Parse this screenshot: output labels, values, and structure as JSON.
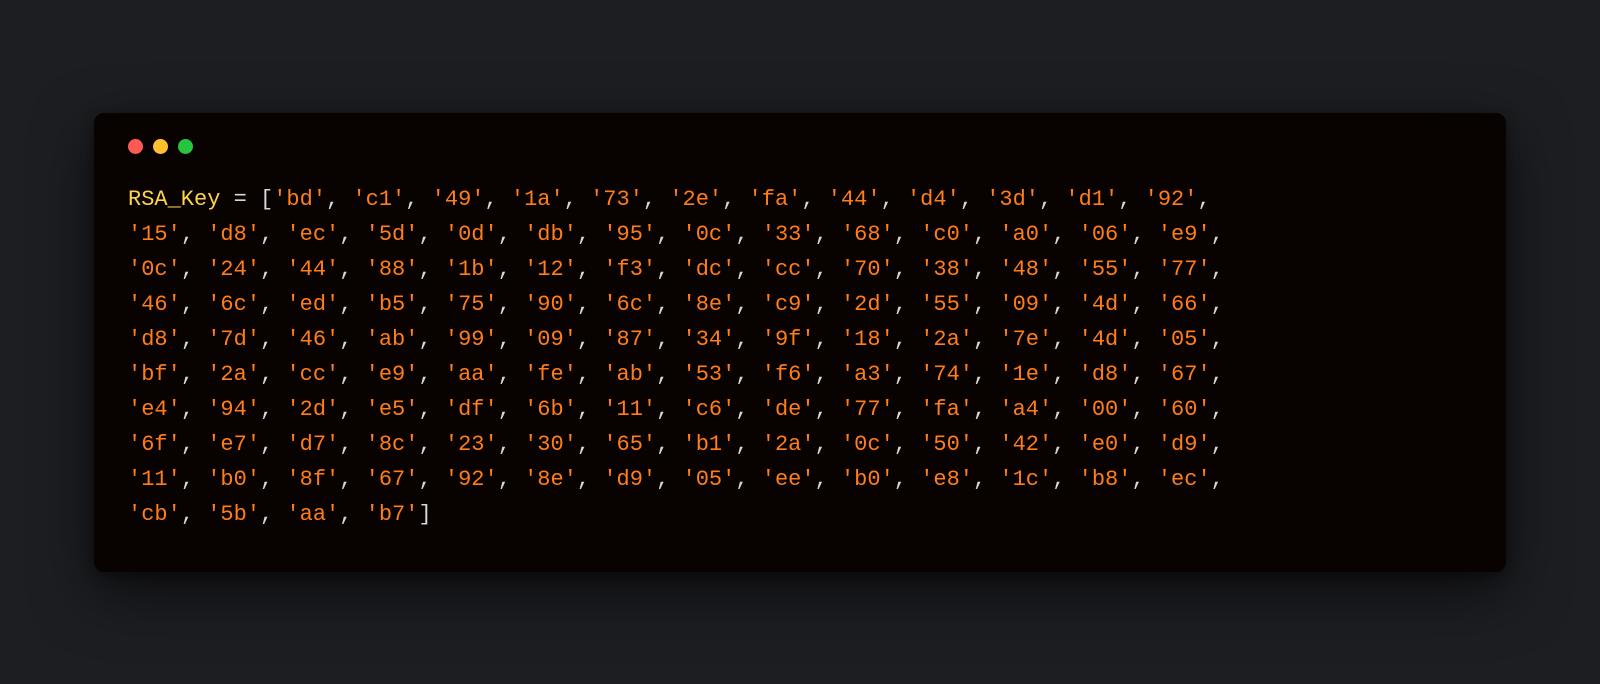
{
  "variable_name": "RSA_Key",
  "assign_op": " = ",
  "open_br": "[",
  "close_br": "]",
  "quote": "'",
  "separator_inner": ", ",
  "separator_tail": ",",
  "rsa_key_bytes": [
    "bd",
    "c1",
    "49",
    "1a",
    "73",
    "2e",
    "fa",
    "44",
    "d4",
    "3d",
    "d1",
    "92",
    "15",
    "d8",
    "ec",
    "5d",
    "0d",
    "db",
    "95",
    "0c",
    "33",
    "68",
    "c0",
    "a0",
    "06",
    "e9",
    "0c",
    "24",
    "44",
    "88",
    "1b",
    "12",
    "f3",
    "dc",
    "cc",
    "70",
    "38",
    "48",
    "55",
    "77",
    "46",
    "6c",
    "ed",
    "b5",
    "75",
    "90",
    "6c",
    "8e",
    "c9",
    "2d",
    "55",
    "09",
    "4d",
    "66",
    "d8",
    "7d",
    "46",
    "ab",
    "99",
    "09",
    "87",
    "34",
    "9f",
    "18",
    "2a",
    "7e",
    "4d",
    "05",
    "bf",
    "2a",
    "cc",
    "e9",
    "aa",
    "fe",
    "ab",
    "53",
    "f6",
    "a3",
    "74",
    "1e",
    "d8",
    "67",
    "e4",
    "94",
    "2d",
    "e5",
    "df",
    "6b",
    "11",
    "c6",
    "de",
    "77",
    "fa",
    "a4",
    "00",
    "60",
    "6f",
    "e7",
    "d7",
    "8c",
    "23",
    "30",
    "65",
    "b1",
    "2a",
    "0c",
    "50",
    "42",
    "e0",
    "d9",
    "11",
    "b0",
    "8f",
    "67",
    "92",
    "8e",
    "d9",
    "05",
    "ee",
    "b0",
    "e8",
    "1c",
    "b8",
    "ec",
    "cb",
    "5b",
    "aa",
    "b7"
  ],
  "first_row_count": 12,
  "per_row_count": 14,
  "window_buttons": [
    "close",
    "minimize",
    "zoom"
  ]
}
